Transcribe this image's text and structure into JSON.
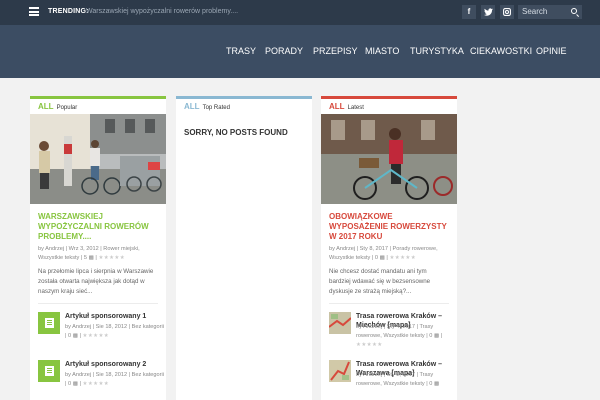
{
  "topbar": {
    "trending_label": "TRENDING:",
    "trending_text": "Warszawskiej wypożyczalni rowerów problemy....",
    "social": [
      "f",
      "t",
      "ig"
    ],
    "search_placeholder": "Search"
  },
  "nav": [
    "TRASY",
    "PORADY",
    "PRZEPISY",
    "MIASTO",
    "TURYSTYKA",
    "CIEKAWOSTKI",
    "OPINIE"
  ],
  "colors": {
    "popular": "#88c540",
    "top_rated": "#8ab8d2",
    "latest": "#d7493c"
  },
  "popular": {
    "all": "ALL",
    "title": "Popular",
    "post_title": "WARSZAWSKIEJ WYPOŻYCZALNI ROWERÓW PROBLEMY....",
    "meta": "by Andrzej | Wrz 3, 2012 | Rower miejski, Wszystkie teksty | 5",
    "excerpt": "Na przełomie lipca i sierpnia w Warszawie została otwarta największa jak dotąd w naszym kraju sieć...",
    "items": [
      {
        "title": "Artykuł sponsorowany 1",
        "meta": "by Andrzej | Sie 18, 2012 | Bez kategorii | 0"
      },
      {
        "title": "Artykuł sponsorowany 2",
        "meta": "by Andrzej | Sie 18, 2012 | Bez kategorii | 0"
      }
    ]
  },
  "top_rated": {
    "all": "ALL",
    "title": "Top Rated",
    "empty": "SORRY, NO POSTS FOUND"
  },
  "latest": {
    "all": "ALL",
    "title": "Latest",
    "post_title": "OBOWIĄZKOWE WYPOSAŻENIE ROWERZYSTY W 2017 ROKU",
    "meta": "by Andrzej | Sty 8, 2017 | Porady rowerowe, Wszystkie teksty | 0",
    "excerpt": "Nie chcesz dostać mandatu ani tym bardziej wdawać się w bezsensowne dyskusje ze strażą miejską?...",
    "items": [
      {
        "title": "Trasa rowerowa Kraków – Miechów [mapa]",
        "meta": "by Andrzej | Sty 4, 2017 | Trasy rowerowe, Wszystkie teksty | 0"
      },
      {
        "title": "Trasa rowerowa Kraków – Warszawa [mapa]",
        "meta": "by Andrzej | Sty 2, 2017 | Trasy rowerowe, Wszystkie teksty | 0"
      }
    ]
  }
}
